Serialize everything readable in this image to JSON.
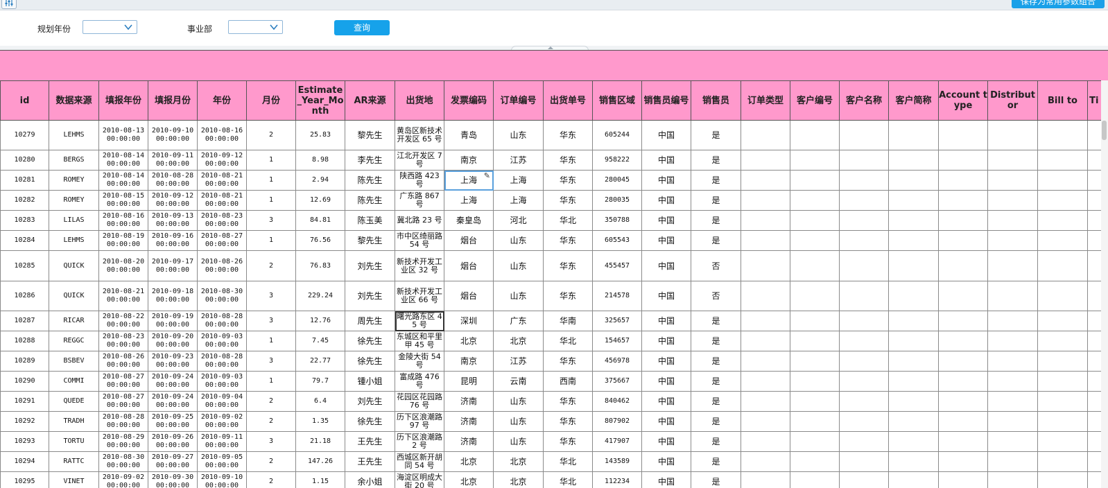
{
  "toolbar": {
    "tool_icon": "settings-sliders-icon",
    "save_label": "保存为常用参数组合"
  },
  "params": {
    "year_label": "规划年份",
    "year_value": "",
    "dept_label": "事业部",
    "dept_value": "",
    "query_label": "查询"
  },
  "colors": {
    "header_bg": "#ff99cc",
    "accent": "#16a2ea"
  },
  "table": {
    "columns": [
      "id",
      "数据来源",
      "填报年份",
      "填报月份",
      "年份",
      "月份",
      "Estimate_Year_Month",
      "AR来源",
      "出货地",
      "发票编码",
      "订单编号",
      "出货单号",
      "销售区域",
      "销售员编号",
      "销售员",
      "订单类型",
      "客户编号",
      "客户名称",
      "客户简称",
      "Account type",
      "Distributor",
      "Bill to",
      "Ti cu"
    ],
    "rows": [
      [
        "10279",
        "LEHMS",
        "2010-08-13 00:00:00",
        "2010-09-10 00:00:00",
        "2010-08-16 00:00:00",
        "2",
        "25.83",
        "黎先生",
        "黄岛区新技术开发区 65 号",
        "青岛",
        "山东",
        "华东",
        "605244",
        "中国",
        "是"
      ],
      [
        "10280",
        "BERGS",
        "2010-08-14 00:00:00",
        "2010-09-11 00:00:00",
        "2010-09-12 00:00:00",
        "1",
        "8.98",
        "李先生",
        "江北开发区 7 号",
        "南京",
        "江苏",
        "华东",
        "958222",
        "中国",
        "是"
      ],
      [
        "10281",
        "ROMEY",
        "2010-08-14 00:00:00",
        "2010-08-28 00:00:00",
        "2010-08-21 00:00:00",
        "1",
        "2.94",
        "陈先生",
        "陕西路 423 号",
        "上海",
        "上海",
        "华东",
        "280045",
        "中国",
        "是"
      ],
      [
        "10282",
        "ROMEY",
        "2010-08-15 00:00:00",
        "2010-09-12 00:00:00",
        "2010-08-21 00:00:00",
        "1",
        "12.69",
        "陈先生",
        "广东路 867 号",
        "上海",
        "上海",
        "华东",
        "280035",
        "中国",
        "是"
      ],
      [
        "10283",
        "LILAS",
        "2010-08-16 00:00:00",
        "2010-09-13 00:00:00",
        "2010-08-23 00:00:00",
        "3",
        "84.81",
        "陈玉美",
        "冀北路 23 号",
        "秦皇岛",
        "河北",
        "华北",
        "350788",
        "中国",
        "是"
      ],
      [
        "10284",
        "LEHMS",
        "2010-08-19 00:00:00",
        "2010-09-16 00:00:00",
        "2010-08-27 00:00:00",
        "1",
        "76.56",
        "黎先生",
        "市中区绮丽路 54 号",
        "烟台",
        "山东",
        "华东",
        "605543",
        "中国",
        "是"
      ],
      [
        "10285",
        "QUICK",
        "2010-08-20 00:00:00",
        "2010-09-17 00:00:00",
        "2010-08-26 00:00:00",
        "2",
        "76.83",
        "刘先生",
        "新技术开发工业区 32 号",
        "烟台",
        "山东",
        "华东",
        "455457",
        "中国",
        "否"
      ],
      [
        "10286",
        "QUICK",
        "2010-08-21 00:00:00",
        "2010-09-18 00:00:00",
        "2010-08-30 00:00:00",
        "3",
        "229.24",
        "刘先生",
        "新技术开发工业区 66 号",
        "烟台",
        "山东",
        "华东",
        "214578",
        "中国",
        "否"
      ],
      [
        "10287",
        "RICAR",
        "2010-08-22 00:00:00",
        "2010-09-19 00:00:00",
        "2010-08-28 00:00:00",
        "3",
        "12.76",
        "周先生",
        "曙光路东区 45 号",
        "深圳",
        "广东",
        "华南",
        "325657",
        "中国",
        "是"
      ],
      [
        "10288",
        "REGGC",
        "2010-08-23 00:00:00",
        "2010-09-20 00:00:00",
        "2010-09-03 00:00:00",
        "1",
        "7.45",
        "徐先生",
        "东城区和平里甲 45 号",
        "北京",
        "北京",
        "华北",
        "154657",
        "中国",
        "是"
      ],
      [
        "10289",
        "BSBEV",
        "2010-08-26 00:00:00",
        "2010-09-23 00:00:00",
        "2010-08-28 00:00:00",
        "3",
        "22.77",
        "徐先生",
        "金陵大街 54 号",
        "南京",
        "江苏",
        "华东",
        "456978",
        "中国",
        "是"
      ],
      [
        "10290",
        "COMMI",
        "2010-08-27 00:00:00",
        "2010-09-24 00:00:00",
        "2010-09-03 00:00:00",
        "1",
        "79.7",
        "锺小姐",
        "富成路 476 号",
        "昆明",
        "云南",
        "西南",
        "375667",
        "中国",
        "是"
      ],
      [
        "10291",
        "QUEDE",
        "2010-08-27 00:00:00",
        "2010-09-24 00:00:00",
        "2010-09-04 00:00:00",
        "2",
        "6.4",
        "刘先生",
        "花园区花园路 76 号",
        "济南",
        "山东",
        "华东",
        "840462",
        "中国",
        "是"
      ],
      [
        "10292",
        "TRADH",
        "2010-08-28 00:00:00",
        "2010-09-25 00:00:00",
        "2010-09-02 00:00:00",
        "2",
        "1.35",
        "徐先生",
        "历下区浪潮路 97 号",
        "济南",
        "山东",
        "华东",
        "807902",
        "中国",
        "是"
      ],
      [
        "10293",
        "TORTU",
        "2010-08-29 00:00:00",
        "2010-09-26 00:00:00",
        "2010-09-11 00:00:00",
        "3",
        "21.18",
        "王先生",
        "历下区浪潮路 2 号",
        "济南",
        "山东",
        "华东",
        "417907",
        "中国",
        "是"
      ],
      [
        "10294",
        "RATTC",
        "2010-08-30 00:00:00",
        "2010-09-27 00:00:00",
        "2010-09-05 00:00:00",
        "2",
        "147.26",
        "王先生",
        "西城区新开胡同 54 号",
        "北京",
        "北京",
        "华北",
        "143589",
        "中国",
        "是"
      ],
      [
        "10295",
        "VINET",
        "2010-09-02 00:00:00",
        "2010-09-30 00:00:00",
        "2010-09-10 00:00:00",
        "2",
        "1.15",
        "余小姐",
        "海淀区明成大街 20 号",
        "北京",
        "北京",
        "华北",
        "112234",
        "中国",
        "是"
      ]
    ]
  }
}
